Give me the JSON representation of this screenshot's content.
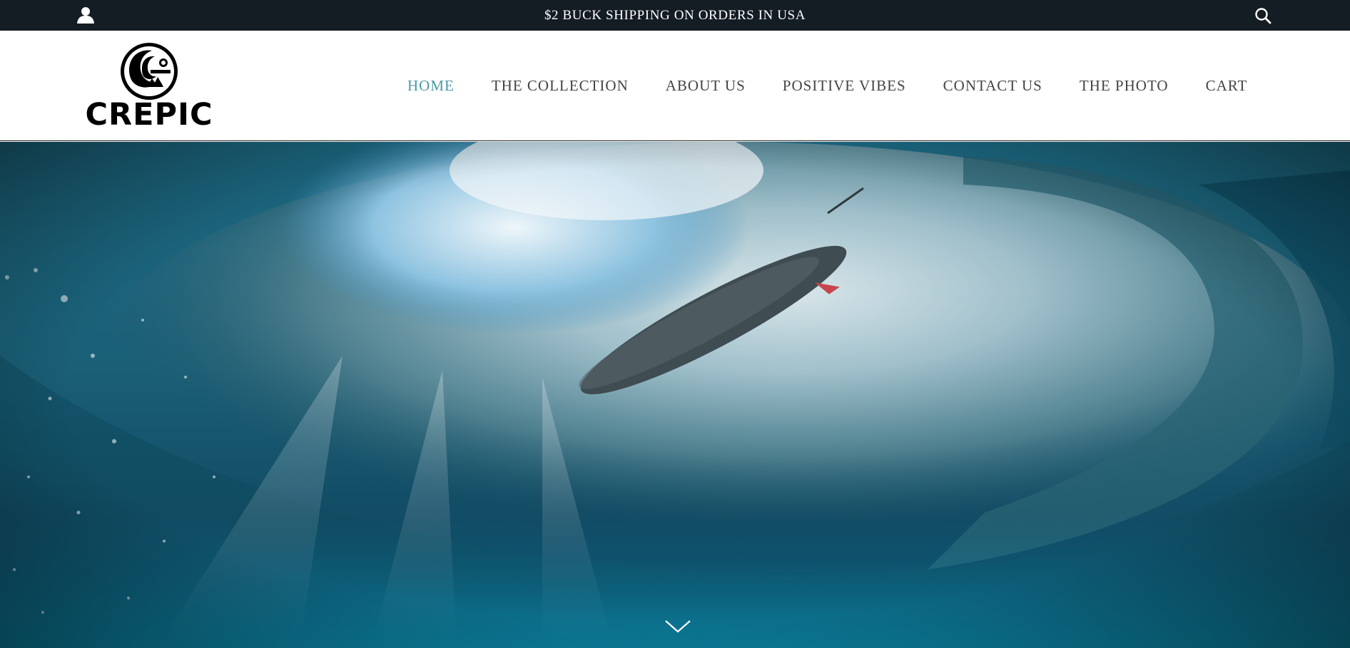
{
  "announcement": {
    "text": "$2 BUCK SHIPPING ON ORDERS IN USA"
  },
  "icons": {
    "account": "account-icon",
    "search": "search-icon",
    "scroll": "chevron-down-icon"
  },
  "logo": {
    "wordmark": "CREPIC"
  },
  "nav": {
    "items": [
      {
        "label": "HOME",
        "active": true
      },
      {
        "label": "THE COLLECTION",
        "active": false
      },
      {
        "label": "ABOUT US",
        "active": false
      },
      {
        "label": "POSITIVE VIBES",
        "active": false
      },
      {
        "label": "CONTACT US",
        "active": false
      },
      {
        "label": "THE PHOTO",
        "active": false
      },
      {
        "label": "CART",
        "active": false
      }
    ]
  },
  "colors": {
    "topbar_bg": "#141c24",
    "nav_active": "#4a9aa6",
    "nav_text": "#444444"
  }
}
